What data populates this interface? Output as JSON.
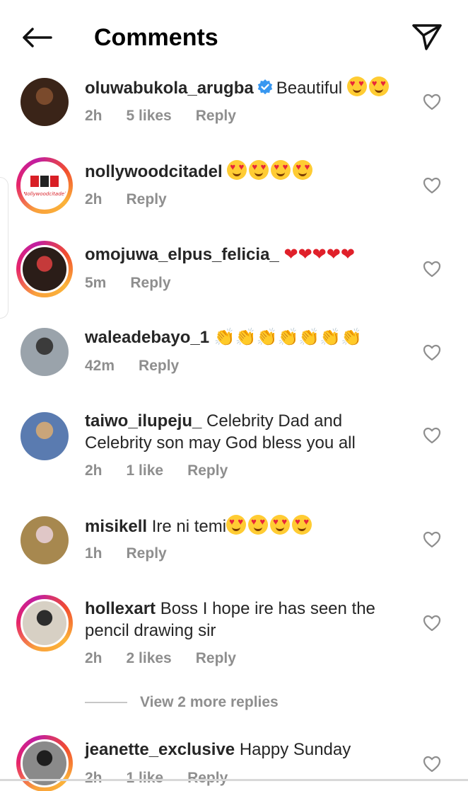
{
  "header": {
    "title": "Comments"
  },
  "comments": [
    {
      "username": "oluwabukola_arugba",
      "verified": true,
      "text": "Beautiful",
      "emojis": [
        "love",
        "love"
      ],
      "time": "2h",
      "likes": "5 likes",
      "reply": "Reply",
      "ring": false,
      "avatar_colors": [
        "#3a2418",
        "#7a4a2c"
      ]
    },
    {
      "username": "nollywoodcitadel",
      "verified": false,
      "text": "",
      "emojis": [
        "love",
        "love",
        "love",
        "love"
      ],
      "time": "2h",
      "likes": "",
      "reply": "Reply",
      "ring": true,
      "avatar_logo": "Nollywoodcitadel",
      "avatar_colors": [
        "#ffffff",
        "#d81f26"
      ]
    },
    {
      "username": "omojuwa_elpus_felicia_",
      "verified": false,
      "text": "",
      "emojis": [
        "heart",
        "heart",
        "heart",
        "heart",
        "heart"
      ],
      "time": "5m",
      "likes": "",
      "reply": "Reply",
      "ring": true,
      "avatar_colors": [
        "#2b1d18",
        "#c53a3a"
      ]
    },
    {
      "username": "waleadebayo_1",
      "verified": false,
      "text": "",
      "emojis": [
        "clap",
        "clap",
        "clap",
        "clap",
        "clap",
        "clap",
        "clap"
      ],
      "time": "42m",
      "likes": "",
      "reply": "Reply",
      "ring": false,
      "avatar_colors": [
        "#9aa3ab",
        "#3b3b3b"
      ]
    },
    {
      "username": "taiwo_ilupeju_",
      "verified": false,
      "text": "Celebrity Dad and Celebrity son may God bless you all",
      "emojis": [],
      "time": "2h",
      "likes": "1 like",
      "reply": "Reply",
      "ring": false,
      "avatar_colors": [
        "#5a7bb0",
        "#c9a57a"
      ]
    },
    {
      "username": "misikell",
      "verified": false,
      "text": "Ire ni temi",
      "emojis": [
        "love",
        "love",
        "love",
        "love"
      ],
      "time": "1h",
      "likes": "",
      "reply": "Reply",
      "ring": false,
      "avatar_colors": [
        "#a7884f",
        "#e0c7c7"
      ]
    },
    {
      "username": "hollexart",
      "verified": false,
      "text": "Boss I hope ire has seen the pencil drawing sir",
      "emojis": [],
      "time": "2h",
      "likes": "2 likes",
      "reply": "Reply",
      "ring": true,
      "avatar_colors": [
        "#d7d0c4",
        "#2c2c2c"
      ]
    },
    {
      "username": "jeanette_exclusive",
      "verified": false,
      "text": "Happy Sunday",
      "emojis": [],
      "time": "2h",
      "likes": "1 like",
      "reply": "Reply",
      "ring": true,
      "avatar_colors": [
        "#8a8a8a",
        "#1e1e1e"
      ]
    }
  ],
  "view_more": "View 2 more replies",
  "colors": {
    "meta_text": "#8e8e8e",
    "verified": "#3897f0",
    "heart": "#e0202a"
  }
}
